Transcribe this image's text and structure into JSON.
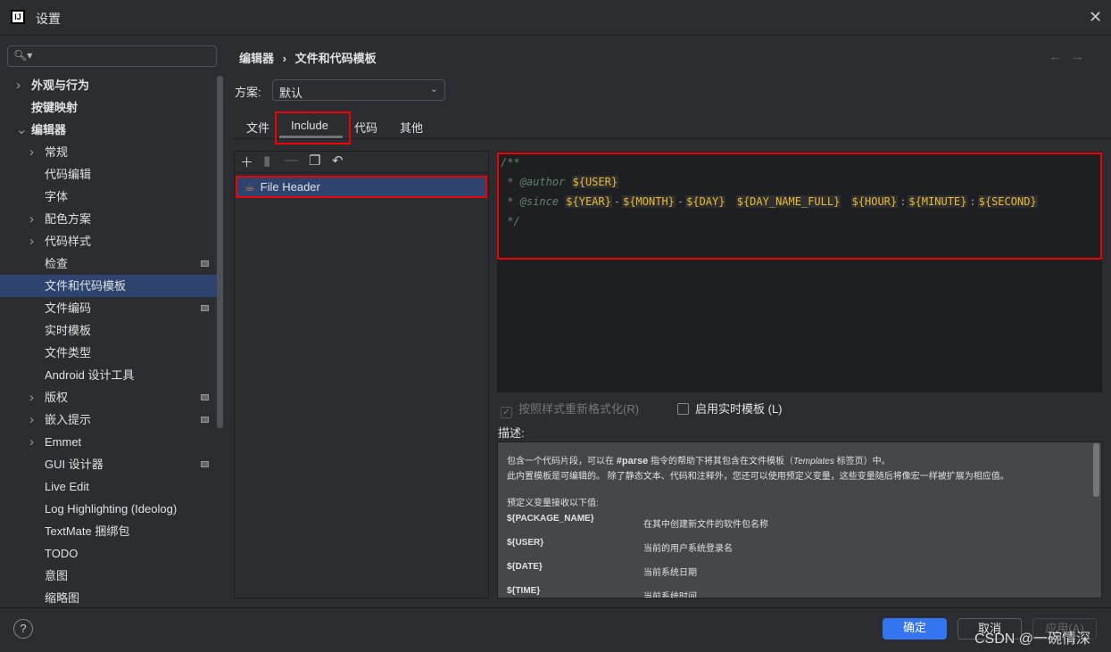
{
  "window": {
    "title": "设置",
    "app_icon": "IJ"
  },
  "search": {
    "placeholder": ""
  },
  "sidebar": {
    "items": [
      {
        "label": "外观与行为",
        "level": 0,
        "chevron": "right",
        "bold": true
      },
      {
        "label": "按键映射",
        "level": 0,
        "chevron": "",
        "bold": true
      },
      {
        "label": "编辑器",
        "level": 0,
        "chevron": "down",
        "bold": true
      },
      {
        "label": "常规",
        "level": 1,
        "chevron": "right"
      },
      {
        "label": "代码编辑",
        "level": 1,
        "chevron": ""
      },
      {
        "label": "字体",
        "level": 1,
        "chevron": ""
      },
      {
        "label": "配色方案",
        "level": 1,
        "chevron": "right"
      },
      {
        "label": "代码样式",
        "level": 1,
        "chevron": "right"
      },
      {
        "label": "检查",
        "level": 1,
        "chevron": "",
        "badge": true
      },
      {
        "label": "文件和代码模板",
        "level": 1,
        "chevron": "",
        "selected": true
      },
      {
        "label": "文件编码",
        "level": 1,
        "chevron": "",
        "badge": true
      },
      {
        "label": "实时模板",
        "level": 1,
        "chevron": ""
      },
      {
        "label": "文件类型",
        "level": 1,
        "chevron": ""
      },
      {
        "label": "Android 设计工具",
        "level": 1,
        "chevron": ""
      },
      {
        "label": "版权",
        "level": 1,
        "chevron": "right",
        "badge": true
      },
      {
        "label": "嵌入提示",
        "level": 1,
        "chevron": "right",
        "badge": true
      },
      {
        "label": "Emmet",
        "level": 1,
        "chevron": "right"
      },
      {
        "label": "GUI 设计器",
        "level": 1,
        "chevron": "",
        "badge": true
      },
      {
        "label": "Live Edit",
        "level": 1,
        "chevron": ""
      },
      {
        "label": "Log Highlighting (Ideolog)",
        "level": 1,
        "chevron": ""
      },
      {
        "label": "TextMate 捆绑包",
        "level": 1,
        "chevron": ""
      },
      {
        "label": "TODO",
        "level": 1,
        "chevron": ""
      },
      {
        "label": "意图",
        "level": 1,
        "chevron": ""
      },
      {
        "label": "缩略图",
        "level": 1,
        "chevron": ""
      }
    ]
  },
  "breadcrumb": {
    "parent": "编辑器",
    "sep": "›",
    "current": "文件和代码模板"
  },
  "scheme": {
    "label": "方案:",
    "value": "默认"
  },
  "tabs": [
    {
      "label": "文件"
    },
    {
      "label": "Include",
      "active": true
    },
    {
      "label": "代码"
    },
    {
      "label": "其他"
    }
  ],
  "templates": {
    "items": [
      {
        "label": "File Header",
        "selected": true
      }
    ]
  },
  "editor": {
    "lines": {
      "l1": "/**",
      "l2_prefix": " * ",
      "author_tag": "@author",
      "user_var": "${USER}",
      "l3_prefix": " * ",
      "since_tag": "@since",
      "vars": [
        "${YEAR}",
        "-",
        "${MONTH}",
        "-",
        "${DAY}",
        " ",
        "${DAY_NAME_FULL}",
        " ",
        "${HOUR}",
        ":",
        "${MINUTE}",
        ":",
        "${SECOND}"
      ],
      "l4": " */"
    }
  },
  "options": {
    "reformat": {
      "label": "按照样式重新格式化(R)",
      "checked": true,
      "disabled": true
    },
    "live_templates": {
      "label": "启用实时模板 (L)",
      "checked": false
    }
  },
  "description": {
    "label": "描述:",
    "p1a": "包含一个代码片段，可以在 ",
    "p1b": "#parse",
    "p1c": " 指令的帮助下将其包含在文件模板（",
    "p1d": "Templates",
    "p1e": " 标签页）中。",
    "p2": "此内置模板是可编辑的。 除了静态文本、代码和注释外，您还可以使用预定义变量，这些变量随后将像宏一样被扩展为相应值。",
    "p3": "预定义变量接收以下值:",
    "vars": [
      {
        "name": "${PACKAGE_NAME}",
        "desc": "在其中创建新文件的软件包名称"
      },
      {
        "name": "${USER}",
        "desc": "当前的用户系统登录名"
      },
      {
        "name": "${DATE}",
        "desc": "当前系统日期"
      },
      {
        "name": "${TIME}",
        "desc": "当前系统时间"
      }
    ]
  },
  "footer": {
    "help": "?",
    "ok": "确定",
    "cancel": "取消",
    "apply": "应用(A)"
  },
  "watermark": "CSDN @一碗情深"
}
